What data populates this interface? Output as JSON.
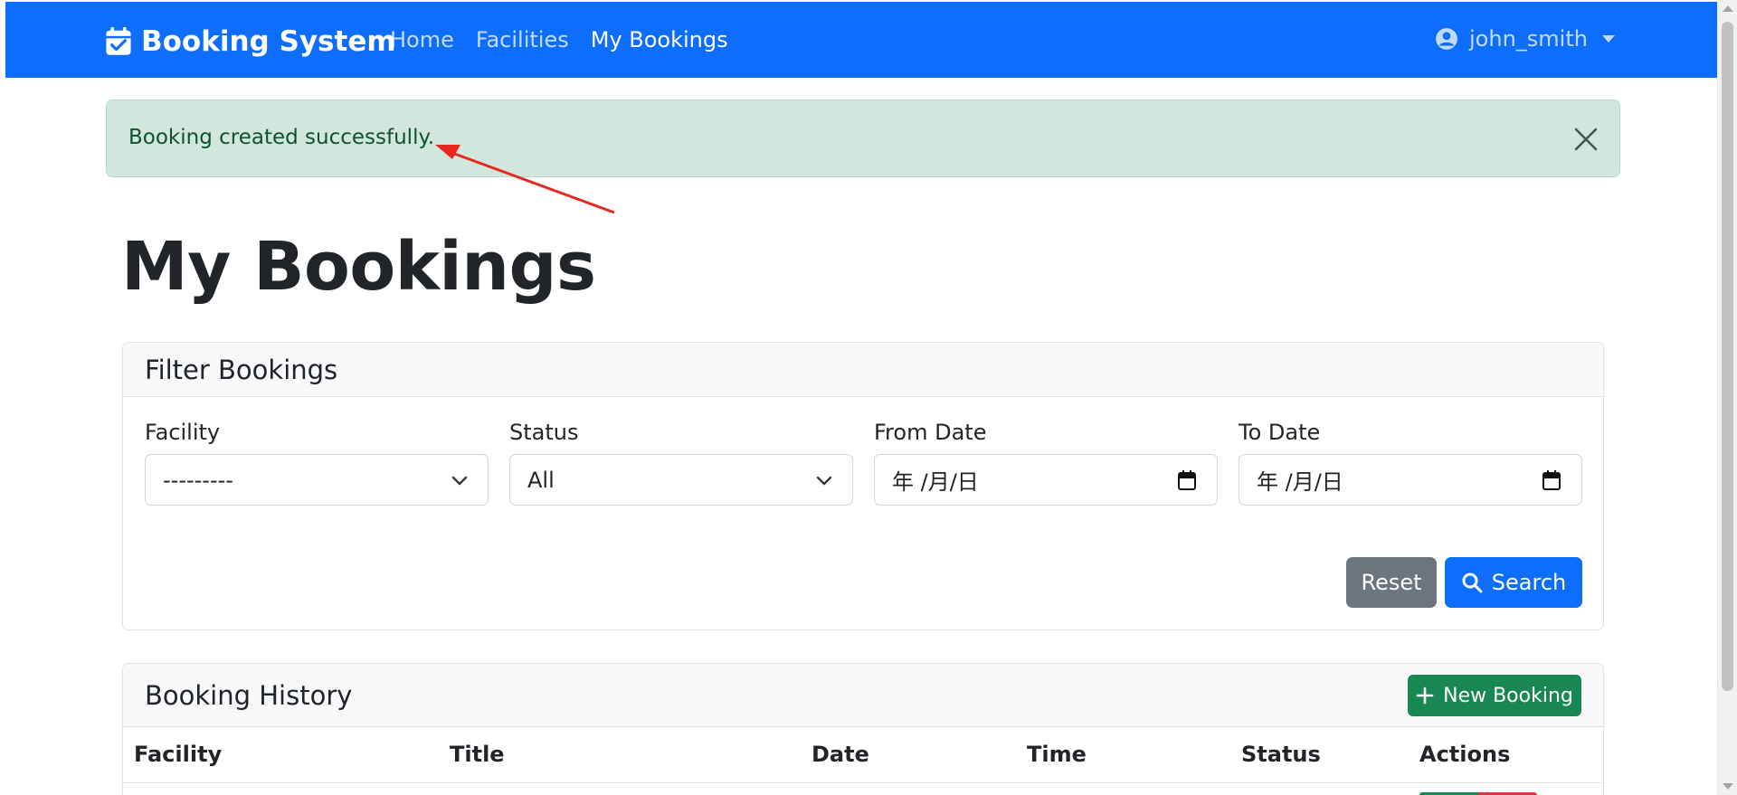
{
  "navbar": {
    "brand": "Booking System",
    "links": [
      "Home",
      "Facilities",
      "My Bookings"
    ],
    "active_link": "My Bookings",
    "user": "john_smith",
    "colors": {
      "background": "#0d6efd"
    }
  },
  "alert": {
    "message": "Booking created successfully.",
    "colors": {
      "background": "#d1e7dd",
      "text": "#0f5132"
    }
  },
  "page_title": "My Bookings",
  "filter": {
    "title": "Filter Bookings",
    "fields": {
      "facility": {
        "label": "Facility",
        "value": "---------"
      },
      "status": {
        "label": "Status",
        "value": "All"
      },
      "from_date": {
        "label": "From Date",
        "placeholder": "年 /月/日"
      },
      "to_date": {
        "label": "To Date",
        "placeholder": "年 /月/日"
      }
    },
    "reset_label": "Reset",
    "search_label": "Search"
  },
  "history": {
    "title": "Booking History",
    "new_label": "New Booking",
    "columns": [
      "Facility",
      "Title",
      "Date",
      "Time",
      "Status",
      "Actions"
    ]
  }
}
